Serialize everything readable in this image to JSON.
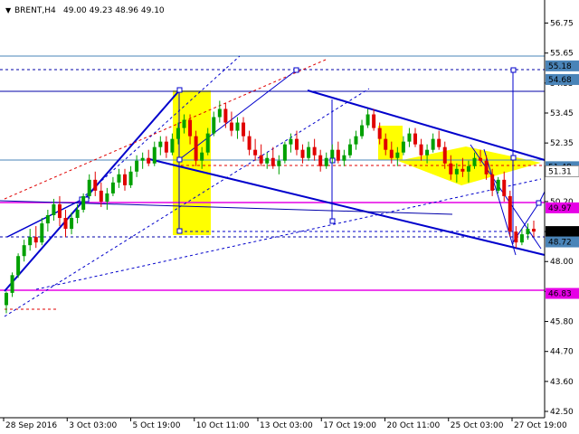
{
  "header": {
    "icon": "triangle-down-icon",
    "symbol": "BRENT,H4",
    "ohlc": "49.00 49.23 48.96 49.10"
  },
  "chart_data": {
    "type": "candlestick",
    "symbol": "BRENT",
    "timeframe": "H4",
    "ylim": [
      42.5,
      57.1
    ],
    "y_ticks": [
      {
        "v": 56.75,
        "label": "56.75"
      },
      {
        "v": 55.65,
        "label": "55.65"
      },
      {
        "v": 54.55,
        "label": "54.55"
      },
      {
        "v": 53.45,
        "label": "53.45"
      },
      {
        "v": 52.35,
        "label": "52.35"
      },
      {
        "v": 51.25,
        "label": "51.25"
      },
      {
        "v": 50.2,
        "label": "50.20"
      },
      {
        "v": 49.1,
        "label": "49.10"
      },
      {
        "v": 48.0,
        "label": "48.00"
      },
      {
        "v": 46.9,
        "label": "46.90"
      },
      {
        "v": 45.8,
        "label": "45.80"
      },
      {
        "v": 44.7,
        "label": "44.70"
      },
      {
        "v": 43.6,
        "label": "43.60"
      },
      {
        "v": 42.5,
        "label": "42.50"
      }
    ],
    "x_labels": [
      "28 Sep 2016",
      "3 Oct 03:00",
      "5 Oct 19:00",
      "10 Oct 11:00",
      "13 Oct 03:00",
      "17 Oct 19:00",
      "20 Oct 11:00",
      "25 Oct 03:00",
      "27 Oct 19:00"
    ],
    "price_tags": [
      {
        "v": 55.18,
        "label": "55.18",
        "color": "#4a84b8"
      },
      {
        "v": 54.68,
        "label": "54.68",
        "color": "#4a84b8"
      },
      {
        "v": 51.48,
        "label": "51.48",
        "color": "#4a84b8"
      },
      {
        "v": 51.31,
        "label": "51.31",
        "color": "#ffffff"
      },
      {
        "v": 49.97,
        "label": "49.97",
        "color": "#e600e6"
      },
      {
        "v": 49.1,
        "label": "49.10",
        "color": "#000000"
      },
      {
        "v": 48.72,
        "label": "48.72",
        "color": "#4a84b8"
      },
      {
        "v": 46.83,
        "label": "46.83",
        "color": "#e600e6"
      }
    ],
    "current_price": 49.1,
    "candles": [
      [
        46.4,
        46.9,
        46.1,
        46.85
      ],
      [
        46.85,
        47.6,
        46.7,
        47.5
      ],
      [
        47.5,
        48.3,
        47.4,
        48.2
      ],
      [
        48.2,
        48.8,
        48.0,
        48.6
      ],
      [
        48.6,
        49.2,
        48.4,
        48.9
      ],
      [
        48.9,
        49.3,
        48.5,
        48.7
      ],
      [
        48.7,
        49.6,
        48.6,
        49.4
      ],
      [
        49.4,
        49.9,
        49.1,
        49.7
      ],
      [
        49.7,
        50.3,
        49.5,
        50.1
      ],
      [
        50.1,
        50.4,
        49.3,
        49.6
      ],
      [
        49.6,
        49.9,
        48.9,
        49.2
      ],
      [
        49.2,
        49.8,
        49.0,
        49.6
      ],
      [
        49.6,
        50.1,
        49.4,
        49.9
      ],
      [
        49.9,
        50.5,
        49.8,
        50.4
      ],
      [
        50.4,
        51.2,
        50.3,
        51.0
      ],
      [
        51.0,
        51.3,
        50.4,
        50.6
      ],
      [
        50.6,
        50.9,
        50.0,
        50.2
      ],
      [
        50.2,
        50.7,
        49.9,
        50.5
      ],
      [
        50.5,
        51.1,
        50.4,
        50.9
      ],
      [
        50.9,
        51.4,
        50.7,
        51.2
      ],
      [
        51.2,
        51.4,
        50.6,
        50.8
      ],
      [
        50.8,
        51.5,
        50.7,
        51.3
      ],
      [
        51.3,
        51.9,
        51.1,
        51.7
      ],
      [
        51.7,
        52.0,
        51.4,
        51.8
      ],
      [
        51.8,
        52.1,
        51.5,
        51.6
      ],
      [
        51.6,
        52.4,
        51.5,
        52.2
      ],
      [
        52.2,
        52.6,
        51.9,
        52.4
      ],
      [
        52.4,
        52.6,
        51.8,
        52.0
      ],
      [
        52.0,
        52.7,
        51.9,
        52.5
      ],
      [
        52.5,
        53.1,
        52.3,
        52.9
      ],
      [
        52.9,
        53.4,
        52.7,
        53.2
      ],
      [
        53.2,
        53.4,
        52.3,
        52.6
      ],
      [
        52.6,
        52.8,
        51.5,
        51.7
      ],
      [
        51.7,
        52.2,
        51.4,
        52.0
      ],
      [
        52.0,
        52.9,
        51.9,
        52.7
      ],
      [
        52.7,
        53.5,
        52.6,
        53.3
      ],
      [
        53.3,
        53.9,
        53.1,
        53.6
      ],
      [
        53.6,
        53.8,
        52.9,
        53.1
      ],
      [
        53.1,
        53.5,
        52.6,
        52.8
      ],
      [
        52.8,
        53.3,
        52.5,
        53.1
      ],
      [
        53.1,
        53.3,
        52.4,
        52.6
      ],
      [
        52.6,
        52.8,
        51.9,
        52.1
      ],
      [
        52.1,
        52.5,
        51.7,
        51.9
      ],
      [
        51.9,
        52.3,
        51.5,
        51.6
      ],
      [
        51.6,
        52.0,
        51.4,
        51.8
      ],
      [
        51.8,
        52.2,
        51.4,
        51.5
      ],
      [
        51.5,
        51.9,
        51.2,
        51.7
      ],
      [
        51.7,
        52.4,
        51.6,
        52.3
      ],
      [
        52.3,
        52.7,
        52.0,
        52.5
      ],
      [
        52.5,
        52.8,
        51.9,
        52.1
      ],
      [
        52.1,
        52.3,
        51.6,
        51.8
      ],
      [
        51.8,
        52.4,
        51.7,
        52.2
      ],
      [
        52.2,
        52.5,
        51.7,
        51.9
      ],
      [
        51.9,
        52.1,
        51.3,
        51.5
      ],
      [
        51.5,
        52.0,
        51.4,
        51.8
      ],
      [
        51.8,
        52.3,
        51.6,
        52.1
      ],
      [
        52.1,
        52.4,
        51.6,
        51.7
      ],
      [
        51.7,
        52.1,
        51.5,
        51.9
      ],
      [
        51.9,
        52.5,
        51.8,
        52.3
      ],
      [
        52.3,
        52.8,
        52.1,
        52.6
      ],
      [
        52.6,
        53.2,
        52.5,
        53.0
      ],
      [
        53.0,
        53.6,
        52.9,
        53.4
      ],
      [
        53.4,
        53.6,
        52.8,
        52.9
      ],
      [
        52.9,
        53.1,
        52.3,
        52.5
      ],
      [
        52.5,
        52.7,
        51.9,
        52.1
      ],
      [
        52.1,
        52.4,
        51.6,
        51.8
      ],
      [
        51.8,
        52.2,
        51.5,
        52.0
      ],
      [
        52.0,
        52.6,
        51.9,
        52.4
      ],
      [
        52.4,
        52.9,
        52.2,
        52.7
      ],
      [
        52.7,
        52.9,
        52.2,
        52.3
      ],
      [
        52.3,
        52.5,
        51.7,
        51.9
      ],
      [
        51.9,
        52.3,
        51.6,
        52.1
      ],
      [
        52.1,
        52.7,
        52.0,
        52.5
      ],
      [
        52.5,
        52.8,
        52.1,
        52.2
      ],
      [
        52.2,
        52.4,
        51.4,
        51.6
      ],
      [
        51.6,
        51.9,
        51.0,
        51.2
      ],
      [
        51.2,
        51.6,
        50.9,
        51.4
      ],
      [
        51.4,
        51.8,
        51.1,
        51.3
      ],
      [
        51.3,
        51.7,
        50.9,
        51.5
      ],
      [
        51.5,
        52.0,
        51.4,
        51.8
      ],
      [
        51.8,
        52.1,
        51.6,
        51.7
      ],
      [
        51.7,
        51.9,
        51.0,
        51.2
      ],
      [
        51.2,
        51.4,
        50.4,
        50.6
      ],
      [
        50.6,
        51.1,
        50.5,
        51.0
      ],
      [
        51.0,
        51.3,
        50.2,
        50.4
      ],
      [
        50.4,
        50.6,
        48.9,
        49.1
      ],
      [
        49.1,
        49.3,
        48.5,
        48.7
      ],
      [
        48.7,
        49.2,
        48.6,
        49.0
      ],
      [
        49.0,
        49.4,
        48.8,
        49.2
      ],
      [
        49.2,
        49.5,
        48.9,
        49.1
      ]
    ]
  }
}
